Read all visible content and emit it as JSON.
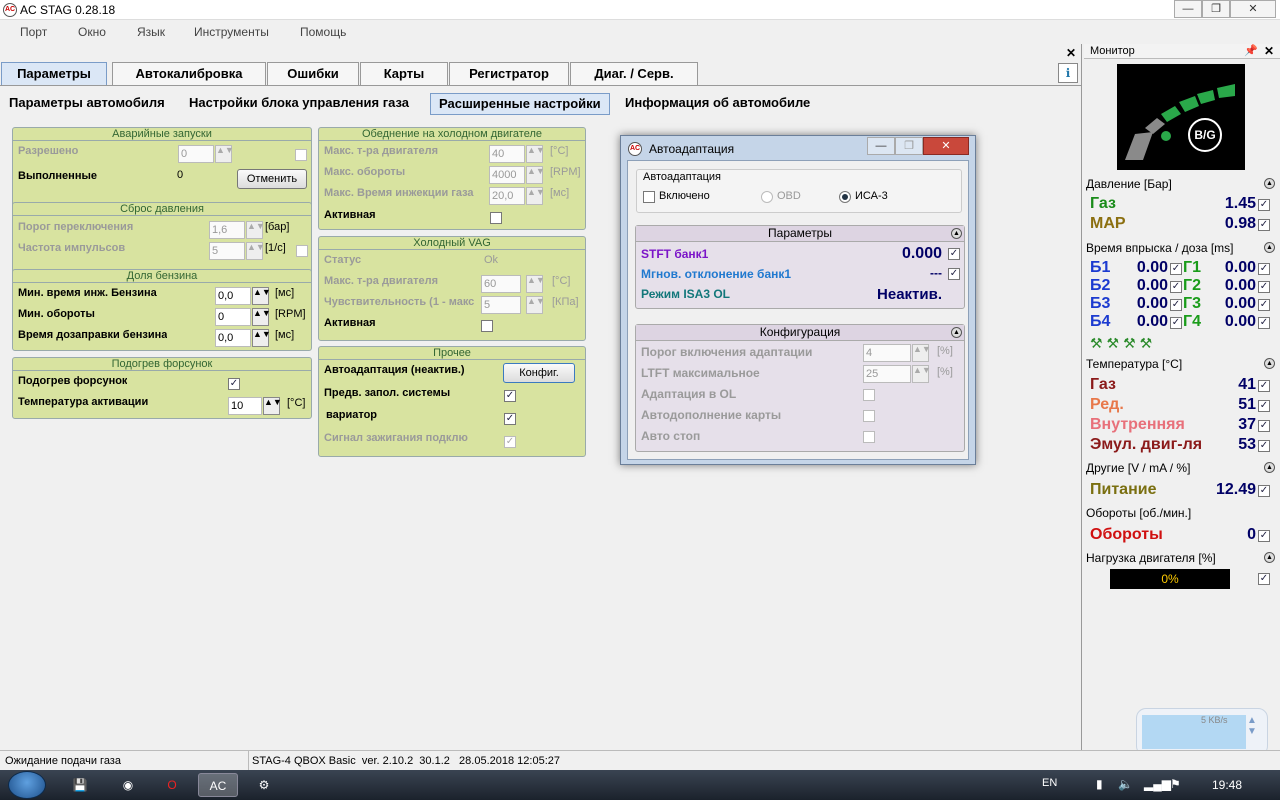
{
  "app": {
    "title": "AC STAG 0.28.18"
  },
  "menu": [
    "Порт",
    "Окно",
    "Язык",
    "Инструменты",
    "Помощь"
  ],
  "tabs": [
    "Параметры",
    "Автокалибровка",
    "Ошибки",
    "Карты",
    "Регистратор",
    "Диаг. / Серв."
  ],
  "subtabs": [
    "Параметры автомобиля",
    "Настройки блока управления газа",
    "Расширенные настройки",
    "Информация об автомобиле"
  ],
  "groups": {
    "emergency": {
      "title": "Аварийные запуски",
      "allowed": "Разрешено",
      "allowed_value": "0",
      "done": "Выполненные",
      "done_value": "0",
      "cancel": "Отменить"
    },
    "pressure_reset": {
      "title": "Сброс давления",
      "threshold": "Порог переключения",
      "threshold_value": "1,6",
      "threshold_unit": "[бар]",
      "pulse": "Частота импульсов",
      "pulse_value": "5",
      "pulse_unit": "[1/с]"
    },
    "petrol_share": {
      "title": "Доля бензина",
      "min_time": "Мин. время инж. Бензина",
      "min_time_value": "0,0",
      "min_time_unit": "[мс]",
      "min_rpm": "Мин. обороты",
      "min_rpm_value": "0",
      "min_rpm_unit": "[RPM]",
      "refuel": "Время дозаправки бензина",
      "refuel_value": "0,0",
      "refuel_unit": "[мс]"
    },
    "injector_heat": {
      "title": "Подогрев форсунок",
      "heat": "Подогрев форсунок",
      "temp": "Температура активации",
      "temp_value": "10",
      "temp_unit": "[°C]"
    },
    "cold_lean": {
      "title": "Обеднение на холодном двигателе",
      "max_temp": "Макс. т-ра двигателя",
      "max_temp_value": "40",
      "max_temp_unit": "[°C]",
      "max_rpm": "Макс. обороты",
      "max_rpm_value": "4000",
      "max_rpm_unit": "[RPM]",
      "max_inj": "Макс. Время инжекции газа",
      "max_inj_value": "20,0",
      "max_inj_unit": "[мс]",
      "active": "Активная"
    },
    "cold_vag": {
      "title": "Холодный VAG",
      "status": "Статус",
      "status_value": "Ok",
      "max_temp": "Макс. т-ра двигателя",
      "max_temp_value": "60",
      "max_temp_unit": "[°C]",
      "sens": "Чувствительность (1 - макс",
      "sens_value": "5",
      "sens_unit": "[КПа]",
      "active": "Активная"
    },
    "other": {
      "title": "Прочее",
      "autoadapt": "Автоадаптация (неактив.)",
      "config": "Конфиг.",
      "prefill": "Предв. запол. системы",
      "variator": "вариатор",
      "ignition": "Сигнал зажигания подклю"
    }
  },
  "dialog": {
    "title": "Автоадаптация",
    "section": "Автоадаптация",
    "enabled": "Включено",
    "obd": "OBD",
    "isa3": "ИСА-3",
    "params_title": "Параметры",
    "stft": "STFT банк1",
    "stft_value": "0.000",
    "inst_dev": "Мгнов. отклонение банк1",
    "inst_dev_value": "---",
    "isa_mode": "Режим ISA3 OL",
    "isa_mode_value": "Неактив.",
    "config_title": "Конфигурация",
    "threshold": "Порог включения адаптации",
    "threshold_value": "4",
    "threshold_unit": "[%]",
    "ltft_max": "LTFT максимальное",
    "ltft_max_value": "25",
    "ltft_unit": "[%]",
    "adapt_ol": "Адаптация в OL",
    "autofill": "Автодополнение карты",
    "autostop": "Авто стоп"
  },
  "monitor": {
    "title": "Монитор",
    "badge": "B/G",
    "pressure_header": "Давление [Бар]",
    "gas": "Газ",
    "gas_value": "1.45",
    "map": "MAP",
    "map_value": "0.98",
    "inj_header": "Время впрыска / доза [ms]",
    "inj": [
      {
        "b": "Б1",
        "bv": "0.00",
        "g": "Г1",
        "gv": "0.00"
      },
      {
        "b": "Б2",
        "bv": "0.00",
        "g": "Г2",
        "gv": "0.00"
      },
      {
        "b": "Б3",
        "bv": "0.00",
        "g": "Г3",
        "gv": "0.00"
      },
      {
        "b": "Б4",
        "bv": "0.00",
        "g": "Г4",
        "gv": "0.00"
      }
    ],
    "temp_header": "Температура [°C]",
    "t_gas": "Газ",
    "t_gas_value": "41",
    "t_red": "Ред.",
    "t_red_value": "51",
    "t_in": "Внутренняя",
    "t_in_value": "37",
    "t_emu": "Эмул. двиг-ля",
    "t_emu_value": "53",
    "other_header": "Другие [V / mA / %]",
    "power": "Питание",
    "power_value": "12.49",
    "rpm_header": "Обороты [об./мин.]",
    "rpm": "Обороты",
    "rpm_value": "0",
    "load_header": "Нагрузка двигателя [%]",
    "load_value": "0%",
    "load_fraction": 0,
    "net_speed": "5 KB/s"
  },
  "status": {
    "left": "Ожидание подачи газа",
    "right": "STAG-4 QBOX Basic  ver. 2.10.2  30.1.2   28.05.2018 12:05:27"
  },
  "taskbar": {
    "lang": "EN",
    "time": "19:48"
  }
}
